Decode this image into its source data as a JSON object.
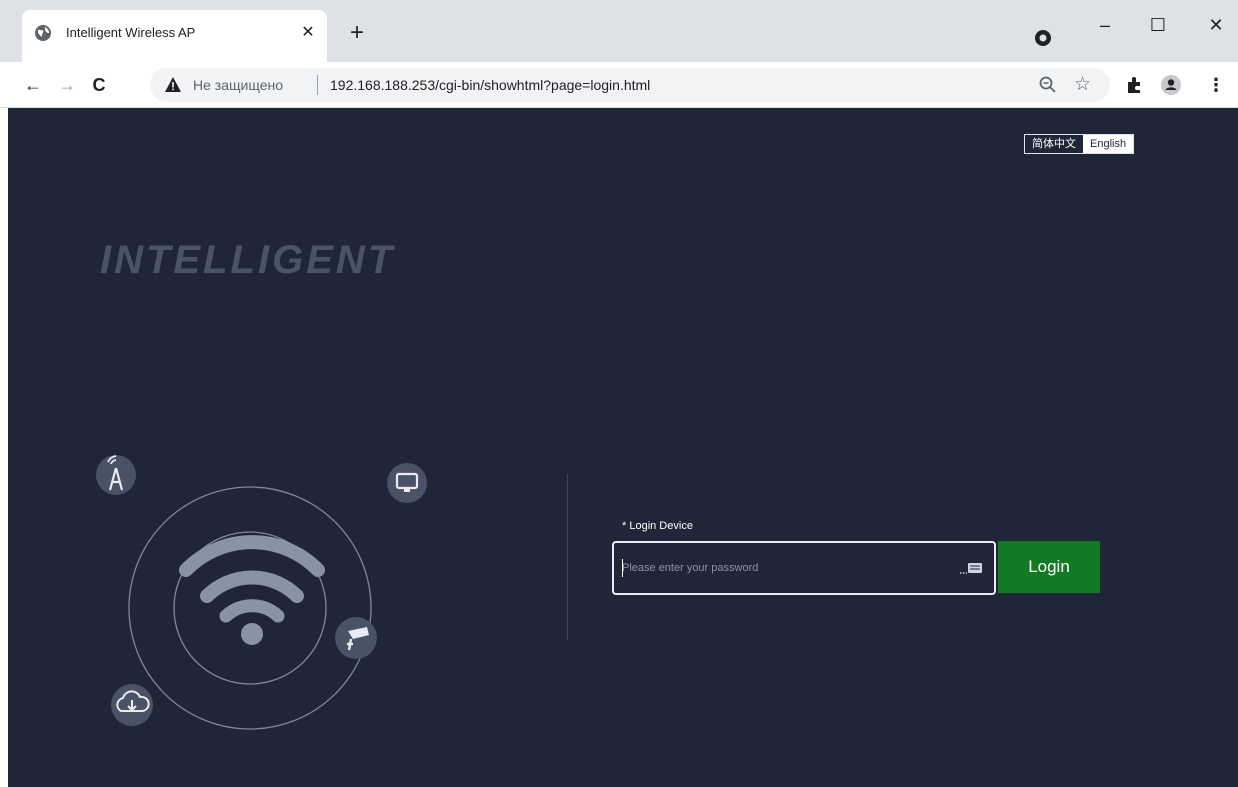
{
  "browser": {
    "tab": {
      "title": "Intelligent Wireless AP",
      "close": "✕"
    },
    "new_tab": "+",
    "window": {
      "minimize": "–",
      "maximize": "☐",
      "close": "✕"
    },
    "address_bar": {
      "security_label": "Не защищено",
      "url": "192.168.188.253/cgi-bin/showhtml?page=login.html"
    },
    "nav": {
      "back": "←",
      "forward": "→",
      "reload": "C"
    },
    "toolbar_more": "⋮",
    "bookmark_star": "☆"
  },
  "page": {
    "language": {
      "chinese": "简体中文",
      "english": "English",
      "selected": "English"
    },
    "brand": "INTELLIGENT",
    "login": {
      "field_label": "* Login Device",
      "password_placeholder": "Please enter your password",
      "password_value": "",
      "button": "Login"
    }
  },
  "colors": {
    "page_background": "#1e2637",
    "login_button": "#117a22",
    "icon_circle": "#4a5366",
    "wifi_arcs": "#8a93a6"
  },
  "icons": [
    "globe-icon",
    "warning-icon",
    "zoom-icon",
    "star-icon",
    "extension-icon",
    "profile-icon",
    "menu-icon",
    "antenna-tower-icon",
    "monitor-icon",
    "cctv-camera-icon",
    "cloud-download-icon",
    "wifi-icon",
    "keyboard-icon"
  ]
}
